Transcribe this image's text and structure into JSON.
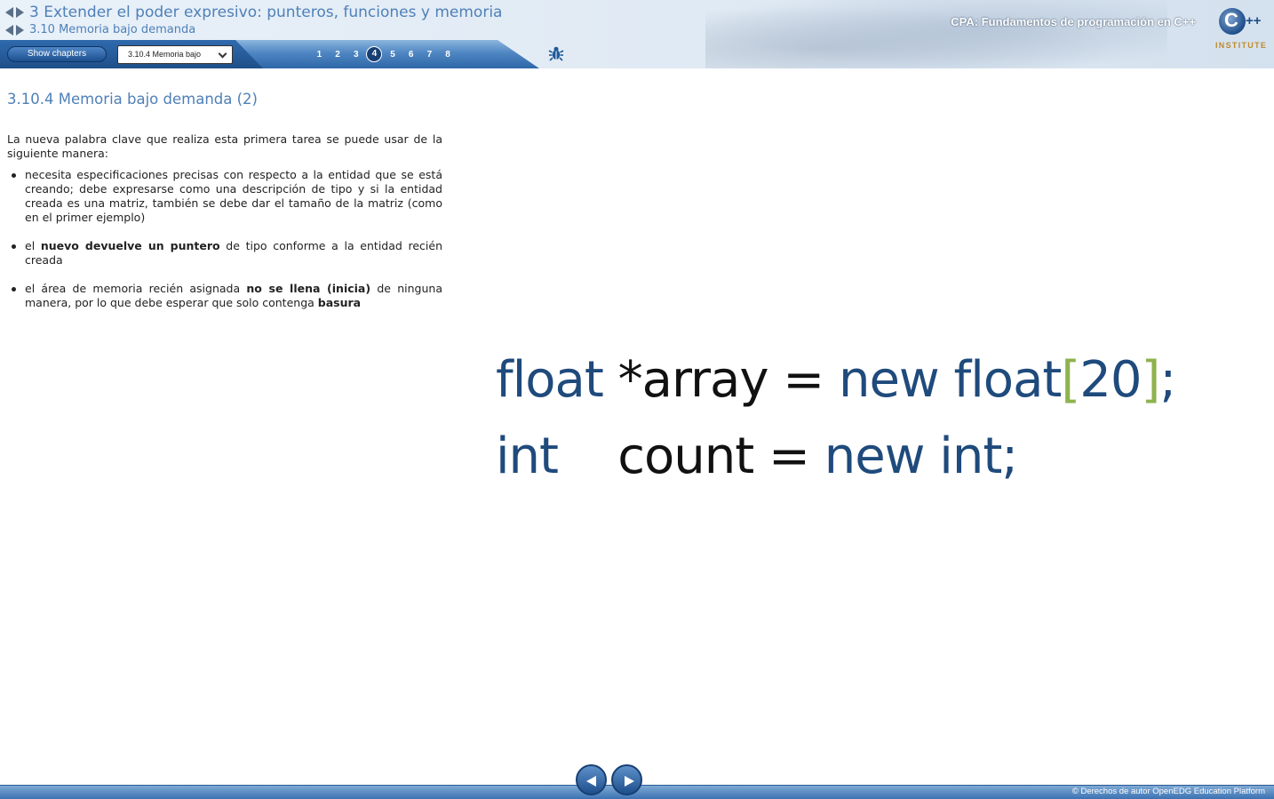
{
  "header": {
    "chapter_title": "3 Extender el poder expresivo: punteros, funciones y memoria",
    "section_title": "3.10 Memoria bajo demanda",
    "course_title": "CPA: Fundamentos de programación en C++",
    "logo_text": "INSTITUTE",
    "logo_plus": "++"
  },
  "toolbar": {
    "show_chapters_label": "Show chapters",
    "section_select_value": "3.10.4 Memoria bajo",
    "pages": [
      "1",
      "2",
      "3",
      "4",
      "5",
      "6",
      "7",
      "8"
    ],
    "active_page": "4",
    "bug_icon": "bug-icon"
  },
  "content": {
    "heading": "3.10.4 Memoria bajo demanda (2)",
    "intro": "La nueva palabra clave que realiza esta primera tarea se puede usar de la siguiente manera:",
    "bullets": [
      {
        "text": "necesita especificaciones precisas con respecto a la entidad que se está creando; debe expresarse como una descripción de tipo y si la entidad creada es una matriz, también se debe dar el tamaño de la matriz (como en el primer ejemplo)"
      },
      {
        "pre": "el ",
        "bold": "nuevo devuelve un puntero",
        "post": " de tipo conforme a la entidad recién creada"
      },
      {
        "pre": "el área de memoria recién asignada ",
        "bold": "no se llena (inicia)",
        "mid": " de ninguna manera, por lo que debe esperar que solo contenga ",
        "bold2": "basura"
      }
    ]
  },
  "code": {
    "line1": {
      "kw1": "float",
      "sp1": " ",
      "id1": "*array = ",
      "kw2": "new float",
      "br1": "[",
      "num": "20",
      "br2": "]",
      "pt": ";"
    },
    "line2": {
      "kw1": "int",
      "sp1": "    ",
      "id1": "count = ",
      "kw2": "new int",
      "pt": ";"
    }
  },
  "footer": {
    "copyright": "© Derechos de autor OpenEDG Education Platform",
    "prev_icon": "prev-arrow-icon",
    "next_icon": "next-arrow-icon"
  },
  "colors": {
    "accent": "#4f80b8",
    "code_keyword": "#1f4a7c",
    "code_bracket": "#8fb24e",
    "toolbar_blue": "#2e67a8"
  }
}
